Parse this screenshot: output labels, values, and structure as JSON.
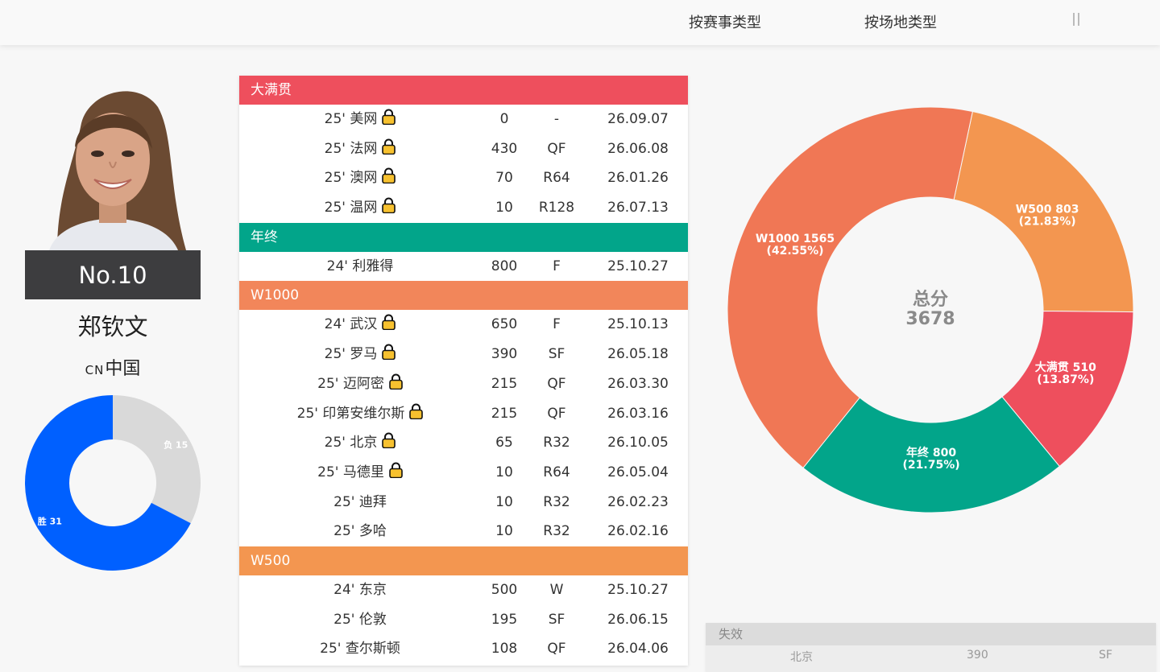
{
  "nav": {
    "tabs": [
      {
        "label": "按赛事类型"
      },
      {
        "label": "按场地类型"
      }
    ],
    "menu_icon": "pause-icon"
  },
  "player": {
    "rank": "No.10",
    "name": "郑钦文",
    "country_code": "CN",
    "country": "中国",
    "win_loss": {
      "wins_label": "胜 31",
      "losses_label": "负 15",
      "wins": 31,
      "losses": 15,
      "colors": {
        "wins": "#0060ff",
        "losses": "#d9d9d9"
      }
    }
  },
  "table": {
    "groups": [
      {
        "title": "大满贯",
        "color": "#ee4f5d",
        "rows": [
          {
            "name": "25' 美网",
            "lock": true,
            "points": "0",
            "round": "-",
            "date": "26.09.07"
          },
          {
            "name": "25' 法网",
            "lock": true,
            "points": "430",
            "round": "QF",
            "date": "26.06.08"
          },
          {
            "name": "25' 澳网",
            "lock": true,
            "points": "70",
            "round": "R64",
            "date": "26.01.26"
          },
          {
            "name": "25' 温网",
            "lock": true,
            "points": "10",
            "round": "R128",
            "date": "26.07.13"
          }
        ]
      },
      {
        "title": "年终",
        "color": "#02a58a",
        "rows": [
          {
            "name": "24' 利雅得",
            "lock": false,
            "points": "800",
            "round": "F",
            "date": "25.10.27"
          }
        ]
      },
      {
        "title": "W1000",
        "color": "#f2865a",
        "rows": [
          {
            "name": "24' 武汉",
            "lock": true,
            "points": "650",
            "round": "F",
            "date": "25.10.13"
          },
          {
            "name": "25' 罗马",
            "lock": true,
            "points": "390",
            "round": "SF",
            "date": "26.05.18"
          },
          {
            "name": "25' 迈阿密",
            "lock": true,
            "points": "215",
            "round": "QF",
            "date": "26.03.30"
          },
          {
            "name": "25' 印第安维尔斯",
            "lock": true,
            "points": "215",
            "round": "QF",
            "date": "26.03.16"
          },
          {
            "name": "25' 北京",
            "lock": true,
            "points": "65",
            "round": "R32",
            "date": "26.10.05"
          },
          {
            "name": "25' 马德里",
            "lock": true,
            "points": "10",
            "round": "R64",
            "date": "26.05.04"
          },
          {
            "name": "25' 迪拜",
            "lock": false,
            "points": "10",
            "round": "R32",
            "date": "26.02.23"
          },
          {
            "name": "25' 多哈",
            "lock": false,
            "points": "10",
            "round": "R32",
            "date": "26.02.16"
          }
        ]
      },
      {
        "title": "W500",
        "color": "#f39650",
        "rows": [
          {
            "name": "24' 东京",
            "lock": false,
            "points": "500",
            "round": "W",
            "date": "25.10.27"
          },
          {
            "name": "25' 伦敦",
            "lock": false,
            "points": "195",
            "round": "SF",
            "date": "26.06.15"
          },
          {
            "name": "25' 查尔斯顿",
            "lock": false,
            "points": "108",
            "round": "QF",
            "date": "26.04.06"
          }
        ]
      }
    ]
  },
  "chart_data": [
    {
      "type": "pie",
      "center_label": "总分",
      "center_value": "3678",
      "slices": [
        {
          "label": "W500 803",
          "pct": "(21.83%)",
          "value": 803,
          "color": "#f39650"
        },
        {
          "label": "大满贯 510",
          "pct": "(13.87%)",
          "value": 510,
          "color": "#ee4f5d"
        },
        {
          "label": "年终 800",
          "pct": "(21.75%)",
          "value": 800,
          "color": "#02a58a"
        },
        {
          "label": "W1000 1565",
          "pct": "(42.55%)",
          "value": 1565,
          "color": "#f07755"
        }
      ]
    },
    {
      "type": "pie",
      "slices": [
        {
          "label": "负 15",
          "value": 15,
          "color": "#d9d9d9"
        },
        {
          "label": "胜 31",
          "value": 31,
          "color": "#0060ff"
        }
      ]
    }
  ],
  "expired": {
    "title": "失效",
    "row": {
      "name": "北京",
      "points": "390",
      "round": "SF"
    }
  }
}
